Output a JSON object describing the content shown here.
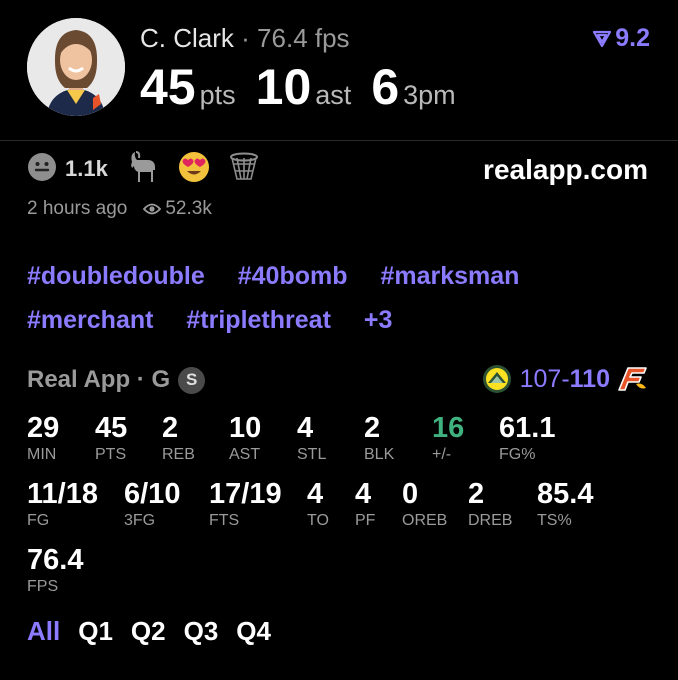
{
  "header": {
    "player_name": "C. Clark",
    "separator": "·",
    "fps_text": "76.4 fps",
    "rating": "9.2",
    "stats": [
      {
        "value": "45",
        "unit": "pts"
      },
      {
        "value": "10",
        "unit": "ast"
      },
      {
        "value": "6",
        "unit": "3pm"
      }
    ]
  },
  "reactions": {
    "count": "1.1k",
    "icons": [
      "smiley-icon",
      "goat-icon",
      "heart-eyes-icon",
      "basketball-hoop-icon"
    ]
  },
  "site": "realapp.com",
  "meta": {
    "time": "2 hours ago",
    "views": "52.3k"
  },
  "tags": [
    "#doubledouble",
    "#40bomb",
    "#marksman",
    "#merchant",
    "#triplethreat",
    "+3"
  ],
  "game": {
    "label": "Real App · G",
    "badge": "S",
    "score_left": "107",
    "score_sep": "-",
    "score_right": "110"
  },
  "stats": [
    {
      "value": "29",
      "label": "MIN"
    },
    {
      "value": "45",
      "label": "PTS"
    },
    {
      "value": "2",
      "label": "REB"
    },
    {
      "value": "10",
      "label": "AST"
    },
    {
      "value": "4",
      "label": "STL"
    },
    {
      "value": "2",
      "label": "BLK"
    },
    {
      "value": "16",
      "label": "+/-"
    },
    {
      "value": "61.1",
      "label": "FG%"
    },
    {
      "value": "11/18",
      "label": "FG"
    },
    {
      "value": "6/10",
      "label": "3FG"
    },
    {
      "value": "17/19",
      "label": "FTS"
    },
    {
      "value": "4",
      "label": "TO"
    },
    {
      "value": "4",
      "label": "PF"
    },
    {
      "value": "0",
      "label": "OREB"
    },
    {
      "value": "2",
      "label": "DREB"
    },
    {
      "value": "85.4",
      "label": "TS%"
    },
    {
      "value": "76.4",
      "label": "FPS"
    }
  ],
  "periods": [
    "All",
    "Q1",
    "Q2",
    "Q3",
    "Q4"
  ],
  "colors": {
    "accent": "#8b7bff",
    "positive": "#3fb27f",
    "muted": "#9a9a9a"
  }
}
